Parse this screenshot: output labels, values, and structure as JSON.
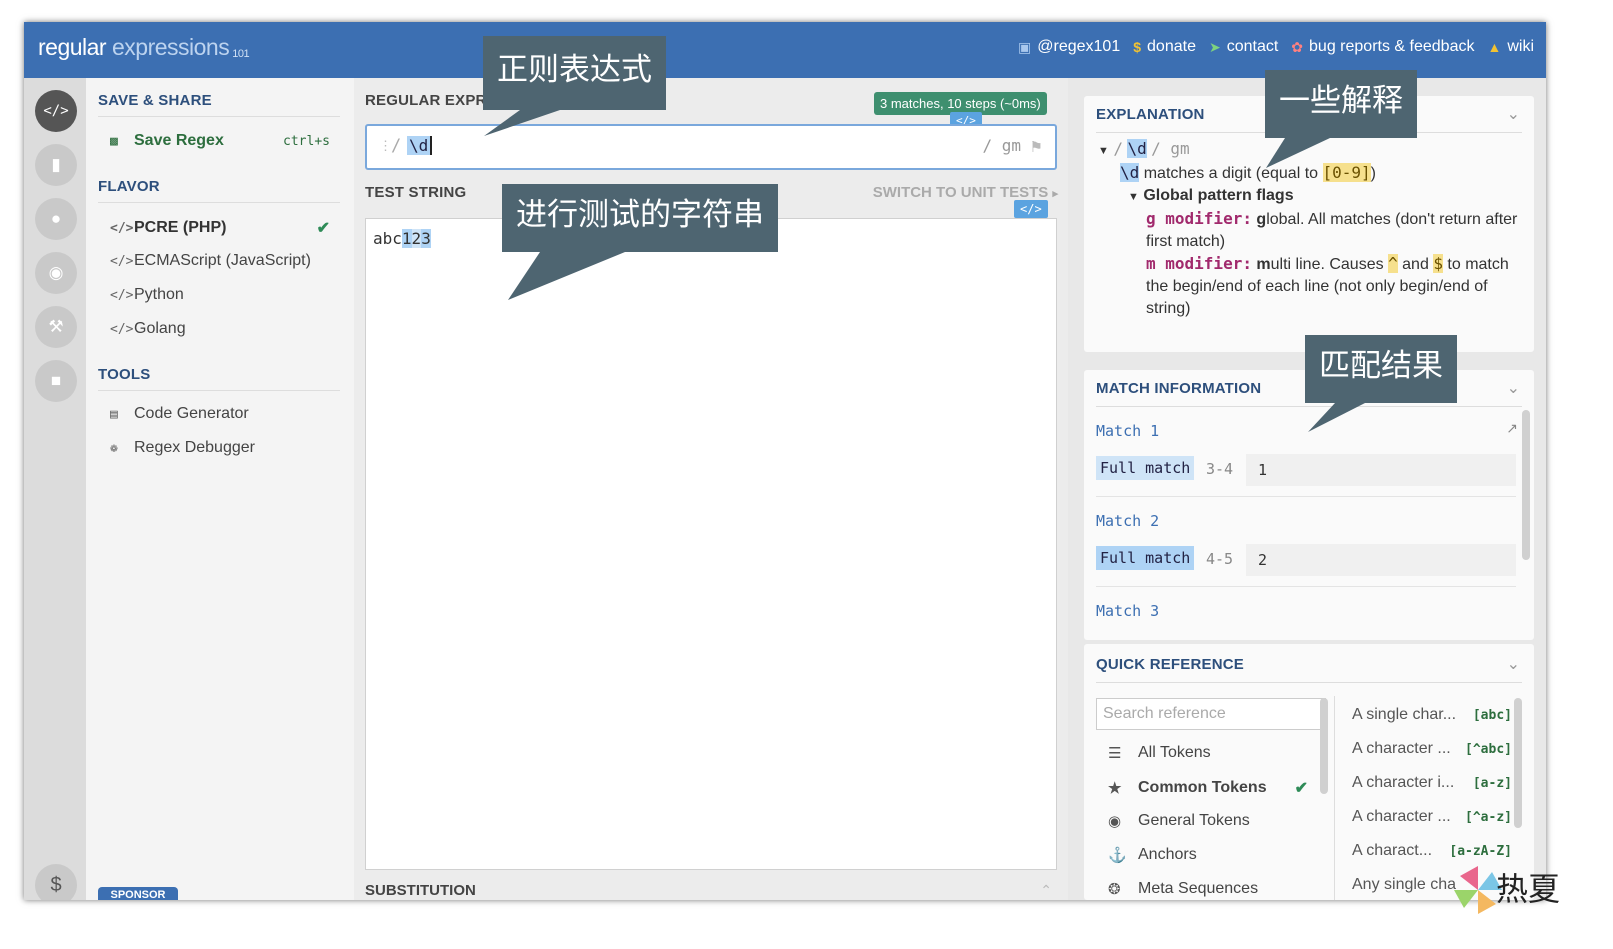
{
  "header": {
    "logo_main": "regular",
    "logo_light": "expressions",
    "logo_sup": "101",
    "links": [
      {
        "icon": "twitter-icon",
        "label": "@regex101"
      },
      {
        "icon": "dollar-icon",
        "label": "donate"
      },
      {
        "icon": "paper-plane-icon",
        "label": "contact"
      },
      {
        "icon": "bug-icon",
        "label": "bug reports & feedback"
      },
      {
        "icon": "bank-icon",
        "label": "wiki"
      }
    ]
  },
  "sidebar": {
    "save_share_title": "SAVE & SHARE",
    "save_label": "Save Regex",
    "save_shortcut": "ctrl+s",
    "flavor_title": "FLAVOR",
    "flavors": [
      "PCRE (PHP)",
      "ECMAScript (JavaScript)",
      "Python",
      "Golang"
    ],
    "selected_flavor": "PCRE (PHP)",
    "tools_title": "TOOLS",
    "tools": [
      "Code Generator",
      "Regex Debugger"
    ],
    "sponsor_label": "SPONSOR"
  },
  "regex": {
    "title": "REGULAR EXPRESSION",
    "badge": "3 matches, 10 steps (~0ms)",
    "tag": "</>",
    "delimiter": "/",
    "expression": "\\d",
    "flags": "/ gm"
  },
  "test": {
    "title": "TEST STRING",
    "switch_label": "SWITCH TO UNIT TESTS",
    "tag": "</>",
    "plain": "abc",
    "match1": "1",
    "match2": "2",
    "match3": "3"
  },
  "substitution": {
    "title": "SUBSTITUTION"
  },
  "explanation": {
    "title": "EXPLANATION",
    "root_delim": "/",
    "root_token": "\\d",
    "root_flags": "/ gm",
    "token": "\\d",
    "token_desc": "matches a digit (equal to",
    "token_range": "[0-9]",
    "token_close": ")",
    "flags_title": "Global pattern flags",
    "g_name": "g modifier:",
    "g_bold": "g",
    "g_desc": "lobal. All matches (don't return after first match)",
    "m_name": "m modifier:",
    "m_bold": "m",
    "m_desc_1": "ulti line. Causes",
    "caret": "^",
    "and": "and",
    "dollar": "$",
    "m_desc_2": "to match the begin/end of each line (not only begin/end of string)"
  },
  "match_info": {
    "title": "MATCH INFORMATION",
    "matches": [
      {
        "label": "Match 1",
        "full": "Full match",
        "range": "3-4",
        "value": "1"
      },
      {
        "label": "Match 2",
        "full": "Full match",
        "range": "4-5",
        "value": "2"
      },
      {
        "label": "Match 3"
      }
    ]
  },
  "quick_ref": {
    "title": "QUICK REFERENCE",
    "search_placeholder": "Search reference",
    "categories": [
      {
        "icon": "database-icon",
        "label": "All Tokens"
      },
      {
        "icon": "star-icon",
        "label": "Common Tokens"
      },
      {
        "icon": "circle-dot-icon",
        "label": "General Tokens"
      },
      {
        "icon": "anchor-icon",
        "label": "Anchors"
      },
      {
        "icon": "life-ring-icon",
        "label": "Meta Sequences"
      }
    ],
    "selected": "Common Tokens",
    "rows": [
      {
        "label": "A single char...",
        "code": "[abc]"
      },
      {
        "label": "A character ...",
        "code": "[^abc]"
      },
      {
        "label": "A character i...",
        "code": "[a-z]"
      },
      {
        "label": "A character ...",
        "code": "[^a-z]"
      },
      {
        "label": "A charact...",
        "code": "[a-zA-Z]"
      },
      {
        "label": "Any single cha",
        "code": ""
      }
    ]
  },
  "callouts": {
    "regex": "正则表达式",
    "test": "进行测试的字符串",
    "explain": "一些解释",
    "match": "匹配结果"
  },
  "watermark": {
    "text": "热夏"
  },
  "colors": {
    "topbar": "#3c6fb2",
    "callout": "#4e6571",
    "match_highlight": "#aed3f5",
    "badge": "#3e8f6f"
  }
}
